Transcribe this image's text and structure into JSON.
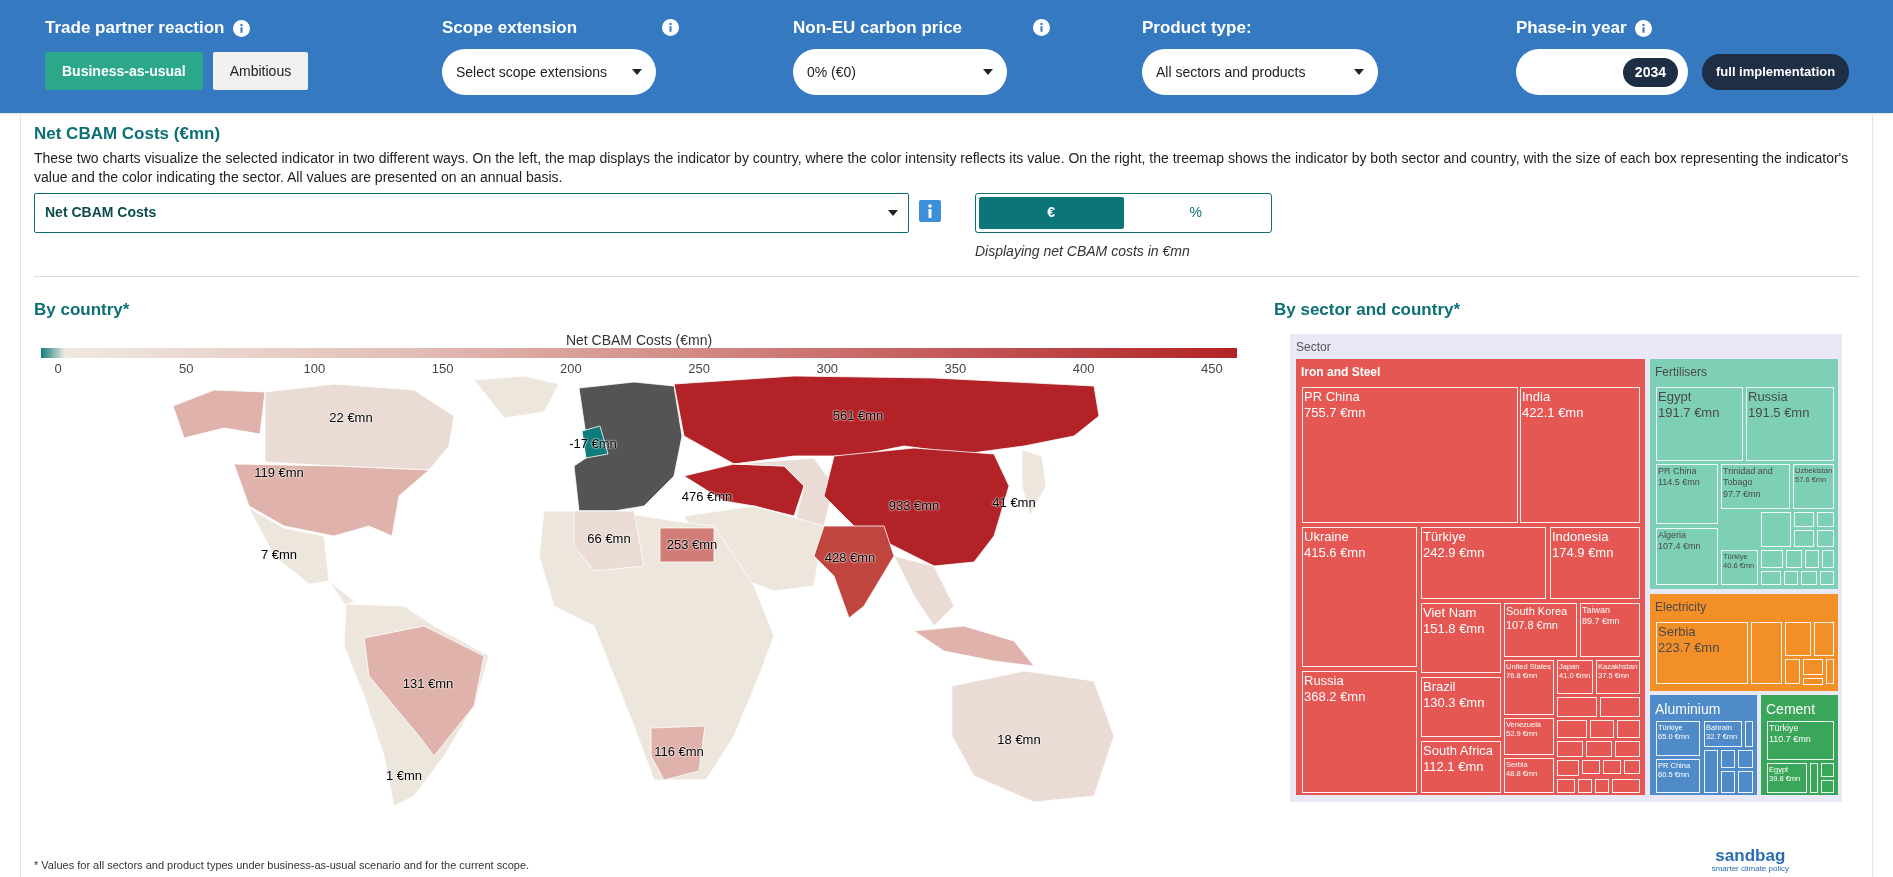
{
  "controls": {
    "trade_partner": {
      "label": "Trade partner reaction",
      "options": [
        {
          "label": "Business-as-usual",
          "selected": true
        },
        {
          "label": "Ambitious",
          "selected": false
        }
      ]
    },
    "scope": {
      "label": "Scope extension",
      "value": "Select scope extensions"
    },
    "carbon_price": {
      "label": "Non-EU carbon price",
      "value": "0% (€0)"
    },
    "product_type": {
      "label": "Product type:",
      "value": "All sectors and products"
    },
    "phase_in": {
      "label": "Phase-in year",
      "value": "2034",
      "button": "full implementation"
    }
  },
  "indicator": {
    "title": "Net CBAM Costs (€mn)",
    "description": "These two charts visualize the selected indicator in two different ways. On the left, the map displays the indicator by country, where the color intensity reflects its value. On the right, the treemap shows the indicator by both sector and country, with the size of each box representing the indicator's value and the color indicating the sector. All values are presented on an annual basis.",
    "select": "Net CBAM Costs",
    "units": [
      {
        "label": "€",
        "selected": true
      },
      {
        "label": "%",
        "selected": false
      }
    ],
    "caption": "Displaying net CBAM costs in €mn"
  },
  "map": {
    "title": "By country*",
    "legend_title": "Net CBAM Costs (€mn)",
    "legend_ticks": [
      "0",
      "50",
      "100",
      "150",
      "200",
      "250",
      "300",
      "350",
      "400",
      "450"
    ],
    "labels": [
      "561 €mn",
      "22 €mn",
      "-17 €mn",
      "119 €mn",
      "476 €mn",
      "933 €mn",
      "41 €mn",
      "66 €mn",
      "253 €mn",
      "428 €mn",
      "7 €mn",
      "131 €mn",
      "116 €mn",
      "18 €mn",
      "1 €mn"
    ]
  },
  "treemap": {
    "title": "By sector and country*",
    "root": "Sector",
    "sectors": [
      {
        "name": "Iron and Steel",
        "color": "#e55753",
        "cells": [
          {
            "label": "PR China",
            "value": "755.7 €mn"
          },
          {
            "label": "India",
            "value": "422.1 €mn"
          },
          {
            "label": "Ukraine",
            "value": "415.6 €mn"
          },
          {
            "label": "Türkiye",
            "value": "242.9 €mn"
          },
          {
            "label": "Indonesia",
            "value": "174.9 €mn"
          },
          {
            "label": "Russia",
            "value": "368.2 €mn"
          },
          {
            "label": "Viet Nam",
            "value": "151.8 €mn"
          },
          {
            "label": "Brazil",
            "value": "130.3 €mn"
          },
          {
            "label": "South Africa",
            "value": "112.1 €mn"
          },
          {
            "label": "South Korea",
            "value": "107.8 €mn"
          },
          {
            "label": "Taiwan",
            "value": "89.7 €mn"
          },
          {
            "label": "United States",
            "value": "76.8 €mn"
          },
          {
            "label": "Japan",
            "value": "41.0 €mn"
          },
          {
            "label": "Kazakhstan",
            "value": "37.5 €mn"
          },
          {
            "label": "Venezuela",
            "value": "52.9 €mn"
          },
          {
            "label": "Serbia",
            "value": "48.8 €mn"
          }
        ]
      },
      {
        "name": "Fertilisers",
        "color": "#7dcfb6",
        "cells": [
          {
            "label": "Egypt",
            "value": "191.7 €mn"
          },
          {
            "label": "Russia",
            "value": "191.5 €mn"
          },
          {
            "label": "PR China",
            "value": "114.5 €mn"
          },
          {
            "label": "Algeria",
            "value": "107.4 €mn"
          },
          {
            "label": "Trinidad and Tobago",
            "value": "97.7 €mn"
          },
          {
            "label": "Uzbekistan",
            "value": "57.6 €mn"
          },
          {
            "label": "Türkiye",
            "value": "40.6 €mn"
          }
        ]
      },
      {
        "name": "Electricity",
        "color": "#f28f27",
        "cells": [
          {
            "label": "Serbia",
            "value": "223.7 €mn"
          }
        ]
      },
      {
        "name": "Aluminium",
        "color": "#4f8bc9",
        "cells": [
          {
            "label": "Türkiye",
            "value": "65.0 €mn"
          },
          {
            "label": "PR China",
            "value": "60.5 €mn"
          },
          {
            "label": "Bahrain",
            "value": "32.7 €mn"
          }
        ]
      },
      {
        "name": "Cement",
        "color": "#3aa65a",
        "cells": [
          {
            "label": "Türkiye",
            "value": "110.7 €mn"
          },
          {
            "label": "Egypt",
            "value": "39.8 €mn"
          }
        ]
      }
    ]
  },
  "footnote": "* Values for all sectors and product types under business-as-usual scenario and for the current scope.",
  "logo": {
    "name": "sandbag",
    "tagline": "smarter climate policy"
  }
}
